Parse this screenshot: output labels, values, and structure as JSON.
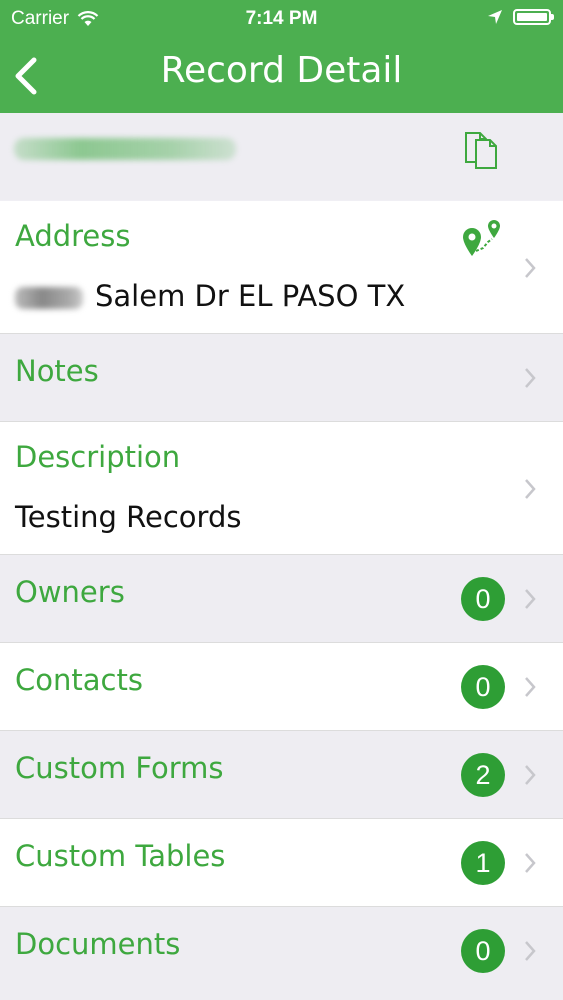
{
  "status_bar": {
    "carrier": "Carrier",
    "time": "7:14 PM"
  },
  "nav": {
    "title": "Record Detail"
  },
  "rows": {
    "address": {
      "label": "Address",
      "value": "Salem Dr EL PASO TX"
    },
    "notes": {
      "label": "Notes"
    },
    "description": {
      "label": "Description",
      "value": "Testing Records"
    },
    "owners": {
      "label": "Owners",
      "count": "0"
    },
    "contacts": {
      "label": "Contacts",
      "count": "0"
    },
    "custom_forms": {
      "label": "Custom Forms",
      "count": "2"
    },
    "custom_tables": {
      "label": "Custom Tables",
      "count": "1"
    },
    "documents": {
      "label": "Documents",
      "count": "0"
    }
  },
  "colors": {
    "accent": "#4caf50",
    "label_green": "#3ea83f",
    "badge_green": "#2e9e35",
    "row_gray": "#eeedf2"
  },
  "icons": [
    "back-icon",
    "copy-icon",
    "map-pins-icon",
    "chevron-right-icon",
    "wifi-icon",
    "location-arrow-icon",
    "battery-icon"
  ]
}
